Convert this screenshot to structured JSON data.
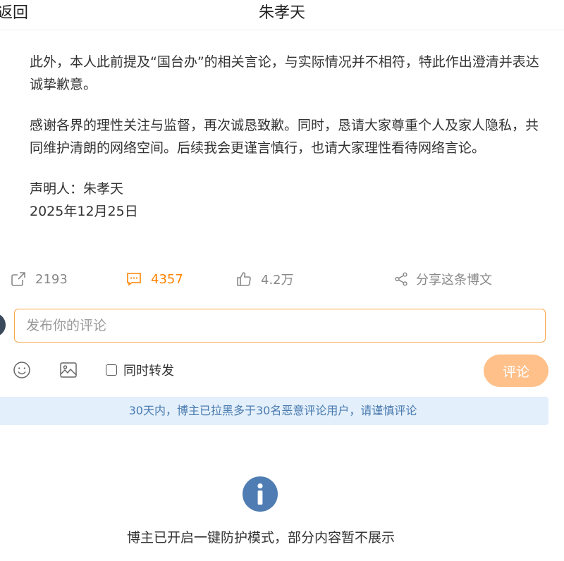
{
  "header": {
    "back_label": "返回",
    "title": "朱孝天"
  },
  "article": {
    "paragraph1": "此外，本人此前提及“国台办”的相关言论，与实际情况并不相符，特此作出澄清并表达诚挚歉意。",
    "paragraph2": "感谢各界的理性关注与监督，再次诚恳致歉。同时，恳请大家尊重个人及家人隐私，共同维护清朗的网络空间。后续我会更谨言慎行，也请大家理性看待网络言论。",
    "signer": "声明人：朱孝天",
    "date": "2025年12月25日"
  },
  "actions": {
    "repost_count": "2193",
    "comment_count": "4357",
    "like_count": "4.2万",
    "share_label": "分享这条博文"
  },
  "comment_box": {
    "placeholder": "发布你的评论",
    "value": "",
    "repost_label": "同时转发",
    "submit_label": "评论"
  },
  "notice": {
    "text": "30天内，博主已拉黑多于30名恶意评论用户，请谨慎评论"
  },
  "protection": {
    "text": "博主已开启一键防护模式，部分内容暂不展示"
  },
  "colors": {
    "accent_orange": "#ff8200",
    "submit_disabled": "#ffc08a",
    "notice_bg": "#e3effa",
    "notice_text": "#4a7bb0",
    "info_icon": "#4f7db3"
  },
  "icons": [
    "repost-icon",
    "comment-icon",
    "like-icon",
    "share-icon",
    "emoji-icon",
    "image-icon",
    "info-icon"
  ]
}
